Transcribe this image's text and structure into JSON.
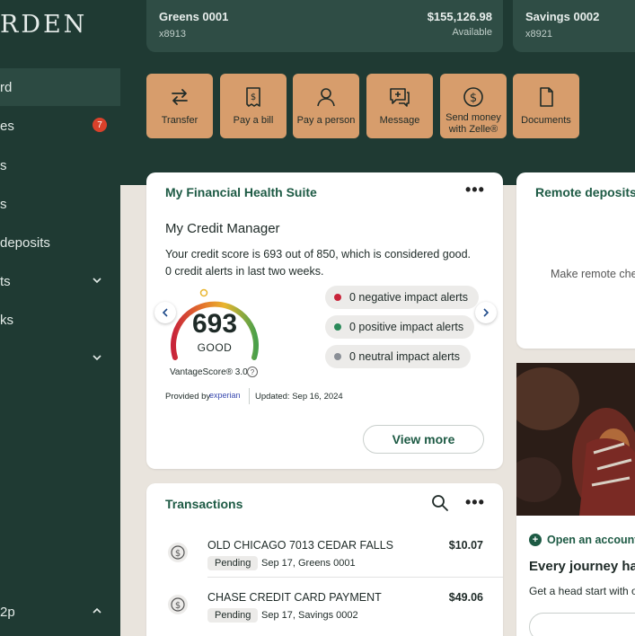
{
  "brand": {
    "logo_text": "RDEN"
  },
  "sidebar": {
    "items": [
      {
        "label": "rd",
        "active": true
      },
      {
        "label": "es",
        "badge": "7"
      },
      {
        "label": "s"
      },
      {
        "label": "s"
      },
      {
        "label": "deposits"
      },
      {
        "label": "ts",
        "chevron": "down"
      },
      {
        "label": "ks"
      },
      {
        "label": "",
        "chevron": "down"
      },
      {
        "label": "2p",
        "chevron": "up"
      }
    ]
  },
  "accounts": [
    {
      "name": "Greens 0001",
      "number": "x8913",
      "balance": "$155,126.98",
      "balance_note": "Available"
    },
    {
      "name": "Savings 0002",
      "number": "x8921"
    }
  ],
  "quick_actions": [
    {
      "label": "Transfer",
      "icon": "transfer-icon"
    },
    {
      "label": "Pay a bill",
      "icon": "bill-icon"
    },
    {
      "label": "Pay a person",
      "icon": "person-icon"
    },
    {
      "label": "Message",
      "icon": "message-icon"
    },
    {
      "label": "Send money with Zelle®",
      "icon": "zelle-icon"
    },
    {
      "label": "Documents",
      "icon": "document-icon"
    }
  ],
  "financial_health": {
    "title": "My Financial Health Suite",
    "credit_manager_title": "My Credit Manager",
    "description_line1": "Your credit score is 693 out of 850, which is considered good.",
    "description_line2": "0 credit alerts in last two weeks.",
    "score": "693",
    "score_rating": "GOOD",
    "score_model": "VantageScore® 3.0",
    "provided_by": "Provided by",
    "provider": "experian",
    "updated": "Updated: Sep 16, 2024",
    "alerts": [
      {
        "label": "0 negative impact alerts",
        "color": "#c8243a"
      },
      {
        "label": "0 positive impact alerts",
        "color": "#2b8a5a"
      },
      {
        "label": "0 neutral impact alerts",
        "color": "#8a8f96"
      }
    ],
    "view_more": "View more"
  },
  "remote_deposits": {
    "title": "Remote deposits",
    "text": "Make remote che"
  },
  "open_account": {
    "link": "Open an account",
    "title": "Every journey has",
    "subtitle": "Get a head start with o"
  },
  "transactions": {
    "title": "Transactions",
    "rows": [
      {
        "name": "OLD CHICAGO 7013 CEDAR FALLS",
        "status": "Pending",
        "meta": "Sep 17, Greens 0001",
        "amount": "$10.07"
      },
      {
        "name": "CHASE CREDIT CARD PAYMENT",
        "status": "Pending",
        "meta": "Sep 17, Savings 0002",
        "amount": "$49.06"
      }
    ]
  },
  "colors": {
    "sidebar_bg": "#1f3a33",
    "action_tile": "#d79d6c",
    "accent_green": "#1d5a44",
    "badge_red": "#d9412b"
  }
}
